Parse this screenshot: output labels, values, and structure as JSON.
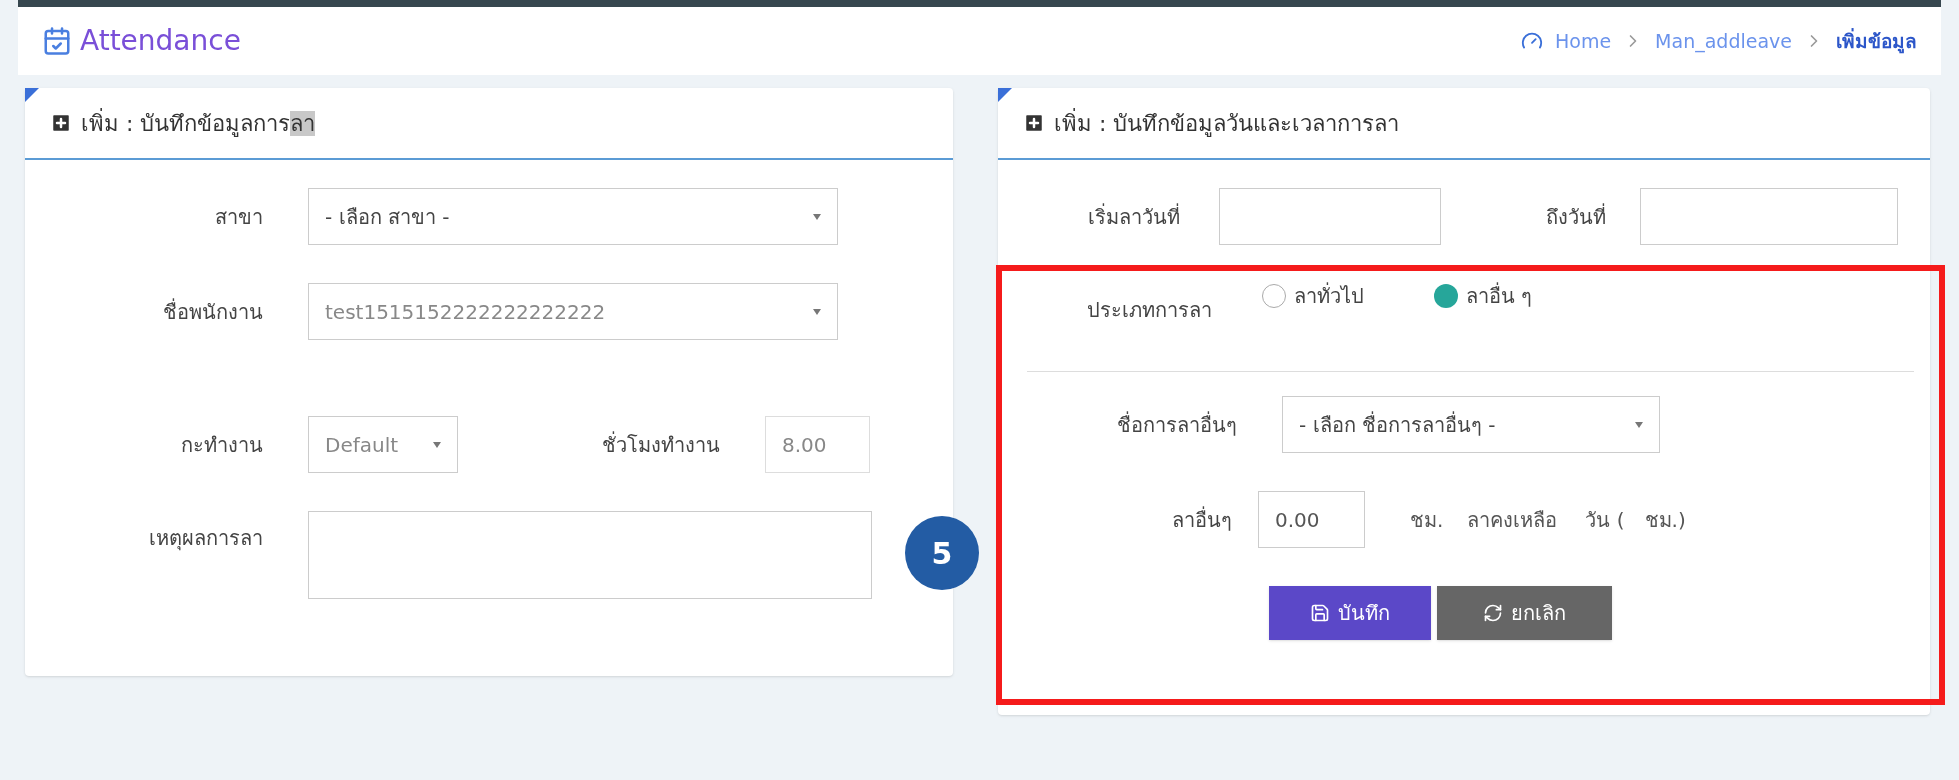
{
  "header": {
    "title": "Attendance",
    "breadcrumbs": [
      {
        "label": "Home",
        "selected": false
      },
      {
        "label": "Man_addleave",
        "selected": false
      },
      {
        "label": "เพิ่มข้อมูล",
        "selected": true
      }
    ]
  },
  "left_card": {
    "title": "เพิ่ม : บันทึกข้อมูลการ",
    "title_selected_part": "ลา",
    "branch": {
      "label": "สาขา",
      "placeholder": "- เลือก สาขา -"
    },
    "employee": {
      "label": "ชื่อพนักงาน",
      "value": "test1515152222222222222"
    },
    "shift": {
      "label": "กะทำงาน",
      "value": "Default"
    },
    "hours": {
      "label": "ชั่วโมงทำงาน",
      "value": "8.00"
    },
    "reason": {
      "label": "เหตุผลการลา"
    }
  },
  "right_card": {
    "title": "เพิ่ม : บันทึกข้อมูลวันและเวลาการลา",
    "start_date": {
      "label": "เริ่มลาวันที่"
    },
    "end_date": {
      "label": "ถึงวันที่"
    },
    "leave_type": {
      "label": "ประเภทการลา",
      "options": [
        {
          "label": "ลาทั่วไป",
          "selected": false
        },
        {
          "label": "ลาอื่น ๆ",
          "selected": true
        }
      ]
    },
    "other_leave_name": {
      "label": "ชื่อการลาอื่นๆ",
      "placeholder": "- เลือก ชื่อการลาอื่นๆ -"
    },
    "other_leave_amount": {
      "label": "ลาอื่นๆ",
      "value": "0.00",
      "unit": "ชม.",
      "remaining_label": "ลาคงเหลือ",
      "days_text": "วัน (",
      "hours_text": "ชม.)"
    },
    "buttons": [
      {
        "label": "บันทึก",
        "kind": "save"
      },
      {
        "label": "ยกเลิก",
        "kind": "cancel"
      }
    ]
  },
  "step_badge": "5"
}
